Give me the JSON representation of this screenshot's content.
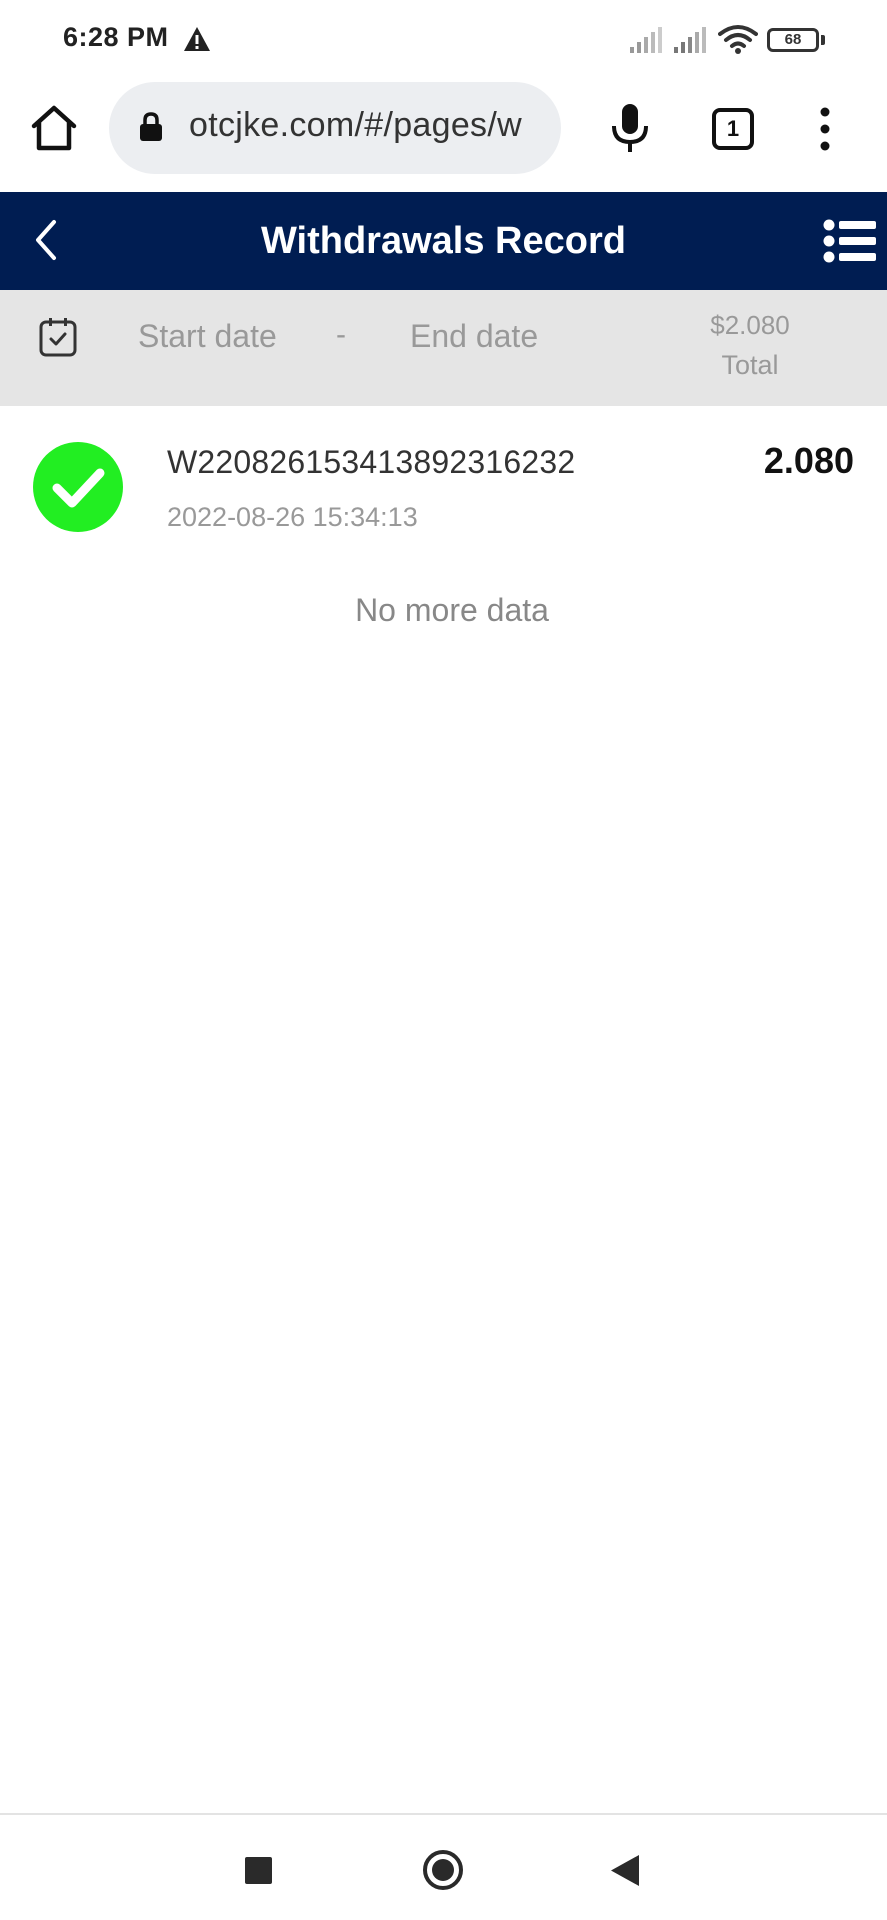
{
  "status_bar": {
    "time": "6:28 PM",
    "battery": "68"
  },
  "browser": {
    "url": "otcjke.com/#/pages/w",
    "tab_count": "1"
  },
  "header": {
    "title": "Withdrawals Record"
  },
  "filter": {
    "start_date_placeholder": "Start date",
    "separator": "-",
    "end_date_placeholder": "End date",
    "total_amount": "$2.080",
    "total_label": "Total"
  },
  "records": [
    {
      "id": "W220826153413892316232",
      "datetime": "2022-08-26 15:34:13",
      "amount": "2.080",
      "status_icon": "check-circle-icon",
      "status_color": "#22ee22"
    }
  ],
  "list_footer": "No more data",
  "colors": {
    "header_bg": "#001d52",
    "filter_bg": "#e5e5e5",
    "success": "#22ee22"
  }
}
